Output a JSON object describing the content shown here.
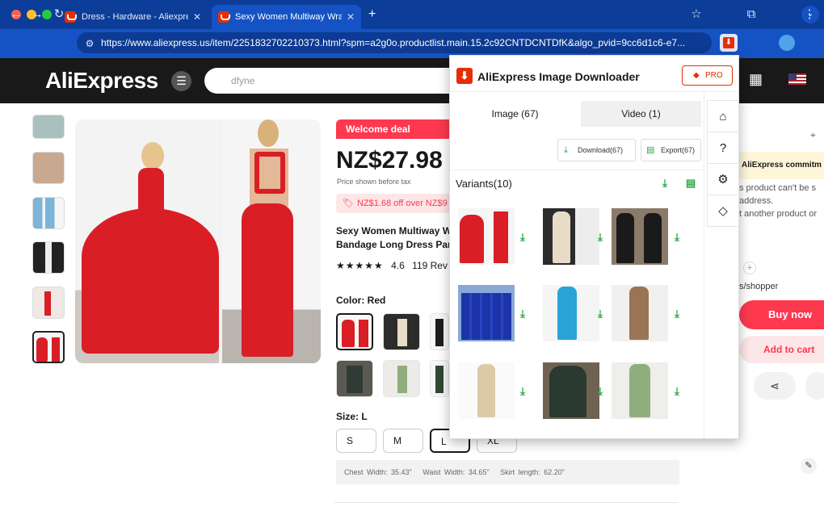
{
  "browser": {
    "tabs": [
      {
        "title": "Dress - Hardware - Aliexpress",
        "active": false
      },
      {
        "title": "Sexy Women Multiway Wrap",
        "active": true
      }
    ],
    "new_tab": "+",
    "url": "https://www.aliexpress.us/item/2251832702210373.html?spm=a2g0o.productlist.main.15.2c92CNTDCNTDfK&algo_pvid=9cc6d1c6-e7..."
  },
  "header": {
    "logo": "AliExpress",
    "search_value": "dfyne"
  },
  "product": {
    "welcome_deal": "Welcome deal",
    "price": "NZ$27.98",
    "price_note": "Price shown before tax",
    "coupon": "NZ$1.68 off over NZ$9",
    "title": "Sexy Women Multiway W Bandage Long Dress Part",
    "rating": "4.6",
    "reviews": "119 Rev",
    "color_label": "Color: Red",
    "size_label": "Size: L",
    "sizes": [
      "S",
      "M",
      "L",
      "XL"
    ],
    "measurements": {
      "chest": "Chest Width: 35.43\"",
      "waist": "Waist Width: 34.65\"",
      "skirt": "Skirt length: 62.20\""
    }
  },
  "sidebar": {
    "commitment": "AliExpress commitm",
    "ship_line1": "s product can't be s",
    "ship_line2": "address.",
    "ship_line3": "t another product or",
    "shopper": "s/shopper",
    "buy_now": "Buy now",
    "add_to_cart": "Add to cart"
  },
  "popup": {
    "title": "AliExpress Image Downloader",
    "pro": "PRO",
    "tab_image": "Image (67)",
    "tab_video": "Video (1)",
    "download": "Download(67)",
    "export": "Export(67)",
    "variants": "Variants(10)"
  },
  "colors": {
    "brand_red": "#fd384f",
    "chrome_blue": "#1553c4",
    "download_green": "#2fa745"
  }
}
